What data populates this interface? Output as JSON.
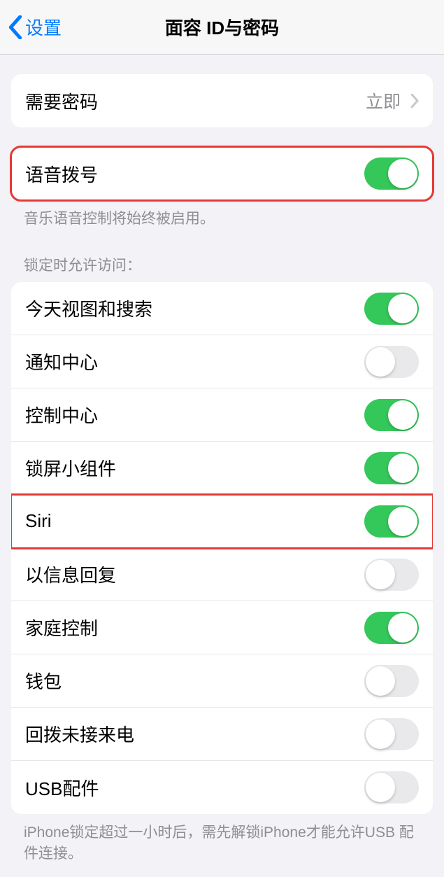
{
  "header": {
    "back_label": "设置",
    "title": "面容 ID与密码"
  },
  "require_passcode": {
    "label": "需要密码",
    "value": "立即"
  },
  "voice_dial": {
    "label": "语音拨号",
    "on": true,
    "footer": "音乐语音控制将始终被启用。"
  },
  "lock_section": {
    "header": "锁定时允许访问：",
    "items": [
      {
        "label": "今天视图和搜索",
        "on": true
      },
      {
        "label": "通知中心",
        "on": false
      },
      {
        "label": "控制中心",
        "on": true
      },
      {
        "label": "锁屏小组件",
        "on": true
      },
      {
        "label": "Siri",
        "on": true
      },
      {
        "label": "以信息回复",
        "on": false
      },
      {
        "label": "家庭控制",
        "on": true
      },
      {
        "label": "钱包",
        "on": false
      },
      {
        "label": "回拨未接来电",
        "on": false
      },
      {
        "label": "USB配件",
        "on": false
      }
    ],
    "footer": "iPhone锁定超过一小时后，需先解锁iPhone才能允许USB 配件连接。"
  },
  "highlights": {
    "voice_dial": true,
    "siri_index": 4
  }
}
